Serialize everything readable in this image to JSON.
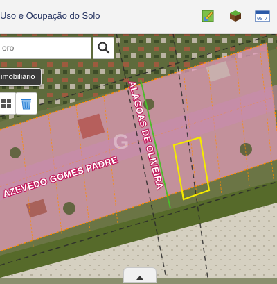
{
  "app": {
    "title": "Uso e Ocupação do Solo"
  },
  "search": {
    "placeholder": "oro"
  },
  "layer_button": {
    "label": "imobiliário"
  },
  "icons": {
    "toolbar": [
      "map-edit-icon",
      "layers-3d-icon",
      "calendar-grid-icon"
    ],
    "search": "search-icon",
    "tools": [
      "grid-icon",
      "trash-bin-icon"
    ],
    "bottom": "chevron-up-icon"
  },
  "map": {
    "streets": [
      {
        "name": "AZEVEDO GOMES PADRE"
      },
      {
        "name": "ALAGOAS DE OLIVEIRA"
      }
    ],
    "colors": {
      "parcel_fill": "#e89cc0",
      "parcel_border": "#ff8c00",
      "selection": "#f5ea00",
      "street_line": "#4dbb2c",
      "street_label_stroke": "#c2185b"
    }
  }
}
